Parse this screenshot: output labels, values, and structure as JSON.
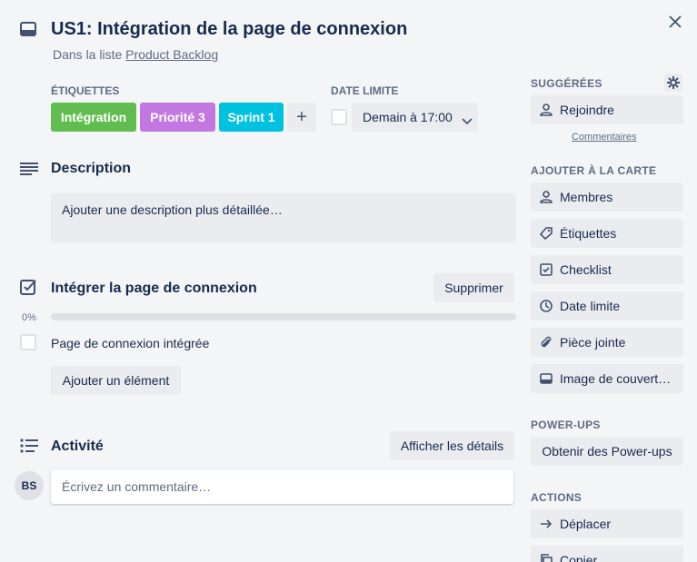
{
  "card": {
    "title": "US1: Intégration de la page de connexion",
    "in_list_prefix": "Dans la liste",
    "list_name": "Product Backlog"
  },
  "labels": {
    "heading": "ÉTIQUETTES",
    "items": [
      {
        "text": "Intégration",
        "color": "#61bd4f"
      },
      {
        "text": "Priorité 3",
        "color": "#c377e0"
      },
      {
        "text": "Sprint 1",
        "color": "#00c2e0"
      }
    ],
    "add_symbol": "+"
  },
  "due": {
    "heading": "DATE LIMITE",
    "value": "Demain à 17:00"
  },
  "description": {
    "title": "Description",
    "placeholder": "Ajouter une description plus détaillée…"
  },
  "checklist": {
    "title": "Intégrer la page de connexion",
    "delete_label": "Supprimer",
    "progress_text": "0%",
    "progress": 0,
    "items": [
      {
        "text": "Page de connexion intégrée",
        "checked": false
      }
    ],
    "add_item_label": "Ajouter un élément"
  },
  "activity": {
    "title": "Activité",
    "details_button": "Afficher les détails",
    "avatar_initials": "BS",
    "comment_placeholder": "Écrivez un commentaire…"
  },
  "sidebar": {
    "suggested_heading": "SUGGÉRÉES",
    "join_label": "Rejoindre",
    "comments_link": "Commentaires",
    "add_heading": "AJOUTER À LA CARTE",
    "add_items": [
      {
        "label": "Membres",
        "icon": "person-icon"
      },
      {
        "label": "Étiquettes",
        "icon": "tag-icon"
      },
      {
        "label": "Checklist",
        "icon": "checklist-icon"
      },
      {
        "label": "Date limite",
        "icon": "clock-icon"
      },
      {
        "label": "Pièce jointe",
        "icon": "paperclip-icon"
      },
      {
        "label": "Image de couvert…",
        "icon": "cover-icon"
      }
    ],
    "powerups_heading": "POWER-UPS",
    "powerups_button": "Obtenir des Power-ups",
    "actions_heading": "ACTIONS",
    "actions": [
      {
        "label": "Déplacer",
        "icon": "arrow-right-icon"
      },
      {
        "label": "Copier",
        "icon": "copy-icon"
      }
    ]
  }
}
